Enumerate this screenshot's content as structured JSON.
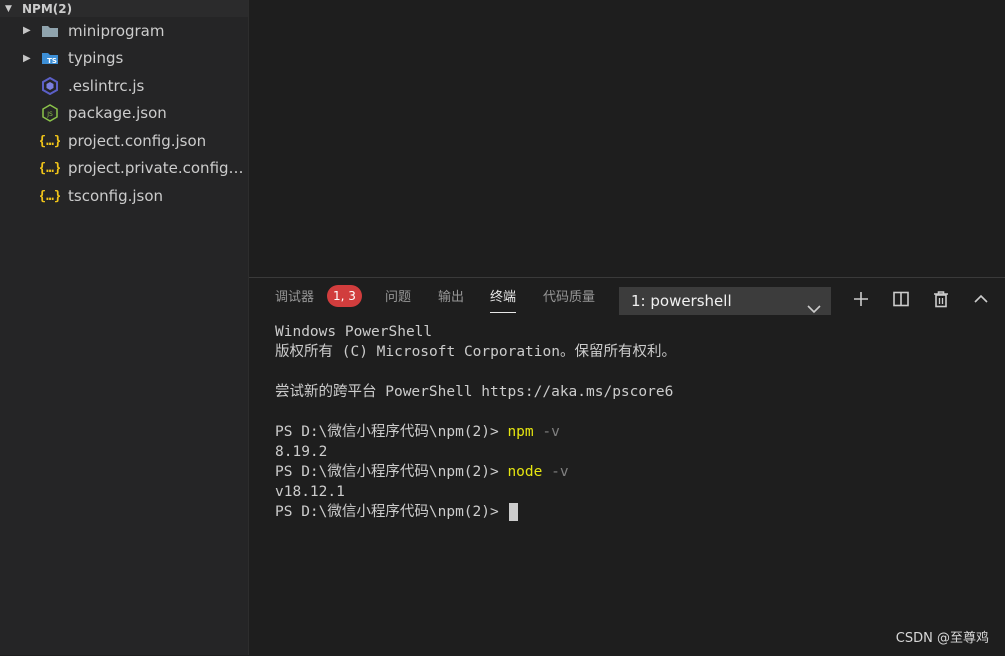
{
  "explorer": {
    "folder_title": "NPM(2)",
    "items": [
      {
        "label": "miniprogram",
        "kind": "folder",
        "icon": "folder-icon"
      },
      {
        "label": "typings",
        "kind": "folder",
        "icon": "ts-folder-icon"
      },
      {
        "label": ".eslintrc.js",
        "kind": "file",
        "icon": "eslint-icon"
      },
      {
        "label": "package.json",
        "kind": "file",
        "icon": "nodejs-icon"
      },
      {
        "label": "project.config.json",
        "kind": "file",
        "icon": "json-braces-icon"
      },
      {
        "label": "project.private.config.js...",
        "kind": "file",
        "icon": "json-braces-icon"
      },
      {
        "label": "tsconfig.json",
        "kind": "file",
        "icon": "json-braces-icon"
      }
    ]
  },
  "panel": {
    "tabs": {
      "debugger": "调试器",
      "problems": "问题",
      "output": "输出",
      "terminal": "终端",
      "code_quality": "代码质量"
    },
    "debugger_badge": "1, 3",
    "active_tab": "terminal",
    "terminal_select": "1: powershell"
  },
  "terminal": {
    "l1": "Windows PowerShell",
    "l2": "版权所有 (C) Microsoft Corporation。保留所有权利。",
    "l3": "尝试新的跨平台 PowerShell https://aka.ms/pscore6",
    "prompt": "PS D:\\微信小程序代码\\npm(2)> ",
    "cmd1": "npm",
    "flag1": " -v",
    "out1": "8.19.2",
    "cmd2": "node",
    "flag2": " -v",
    "out2": "v18.12.1"
  },
  "watermark": "CSDN @至尊鸡",
  "colors": {
    "background": "#1e1e1e",
    "sidebar": "#252526",
    "badge": "#d13d3d",
    "command": "#e5e510"
  }
}
